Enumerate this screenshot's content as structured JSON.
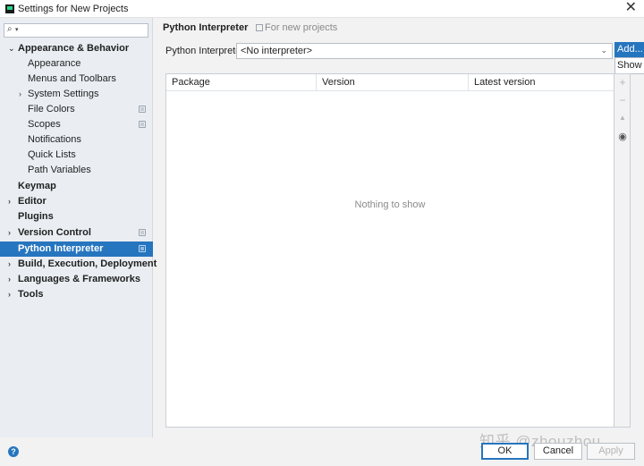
{
  "window": {
    "title": "Settings for New Projects",
    "close_icon": "close-icon"
  },
  "sidebar": {
    "search_placeholder": "",
    "items": [
      {
        "label": "Appearance & Behavior",
        "bold": true,
        "expanded": true
      },
      {
        "label": "Appearance"
      },
      {
        "label": "Menus and Toolbars"
      },
      {
        "label": "System Settings"
      },
      {
        "label": "File Colors"
      },
      {
        "label": "Scopes"
      },
      {
        "label": "Notifications"
      },
      {
        "label": "Quick Lists"
      },
      {
        "label": "Path Variables"
      },
      {
        "label": "Keymap",
        "bold": true
      },
      {
        "label": "Editor",
        "bold": true
      },
      {
        "label": "Plugins",
        "bold": true
      },
      {
        "label": "Version Control",
        "bold": true
      },
      {
        "label": "Python Interpreter",
        "bold": true,
        "selected": true
      },
      {
        "label": "Build, Execution, Deployment",
        "bold": true
      },
      {
        "label": "Languages & Frameworks",
        "bold": true
      },
      {
        "label": "Tools",
        "bold": true
      }
    ]
  },
  "panel": {
    "title": "Python Interpreter",
    "scope": "For new projects",
    "interpreter_label": "Python Interpreter:",
    "interpreter_value": "<No interpreter>",
    "add_button": "Add...",
    "dropdown_item": "Show All..."
  },
  "table": {
    "columns": [
      "Package",
      "Version",
      "Latest version"
    ],
    "empty_text": "Nothing to show"
  },
  "tools": {
    "add": "+",
    "remove": "−",
    "up": "▲",
    "eye": "👁"
  },
  "footer": {
    "help": "?",
    "ok": "OK",
    "cancel": "Cancel",
    "apply": "Apply",
    "watermark": "知乎 @zhouzhou"
  },
  "colors": {
    "accent": "#2675bf",
    "sidebar_bg": "#eaeef3"
  }
}
